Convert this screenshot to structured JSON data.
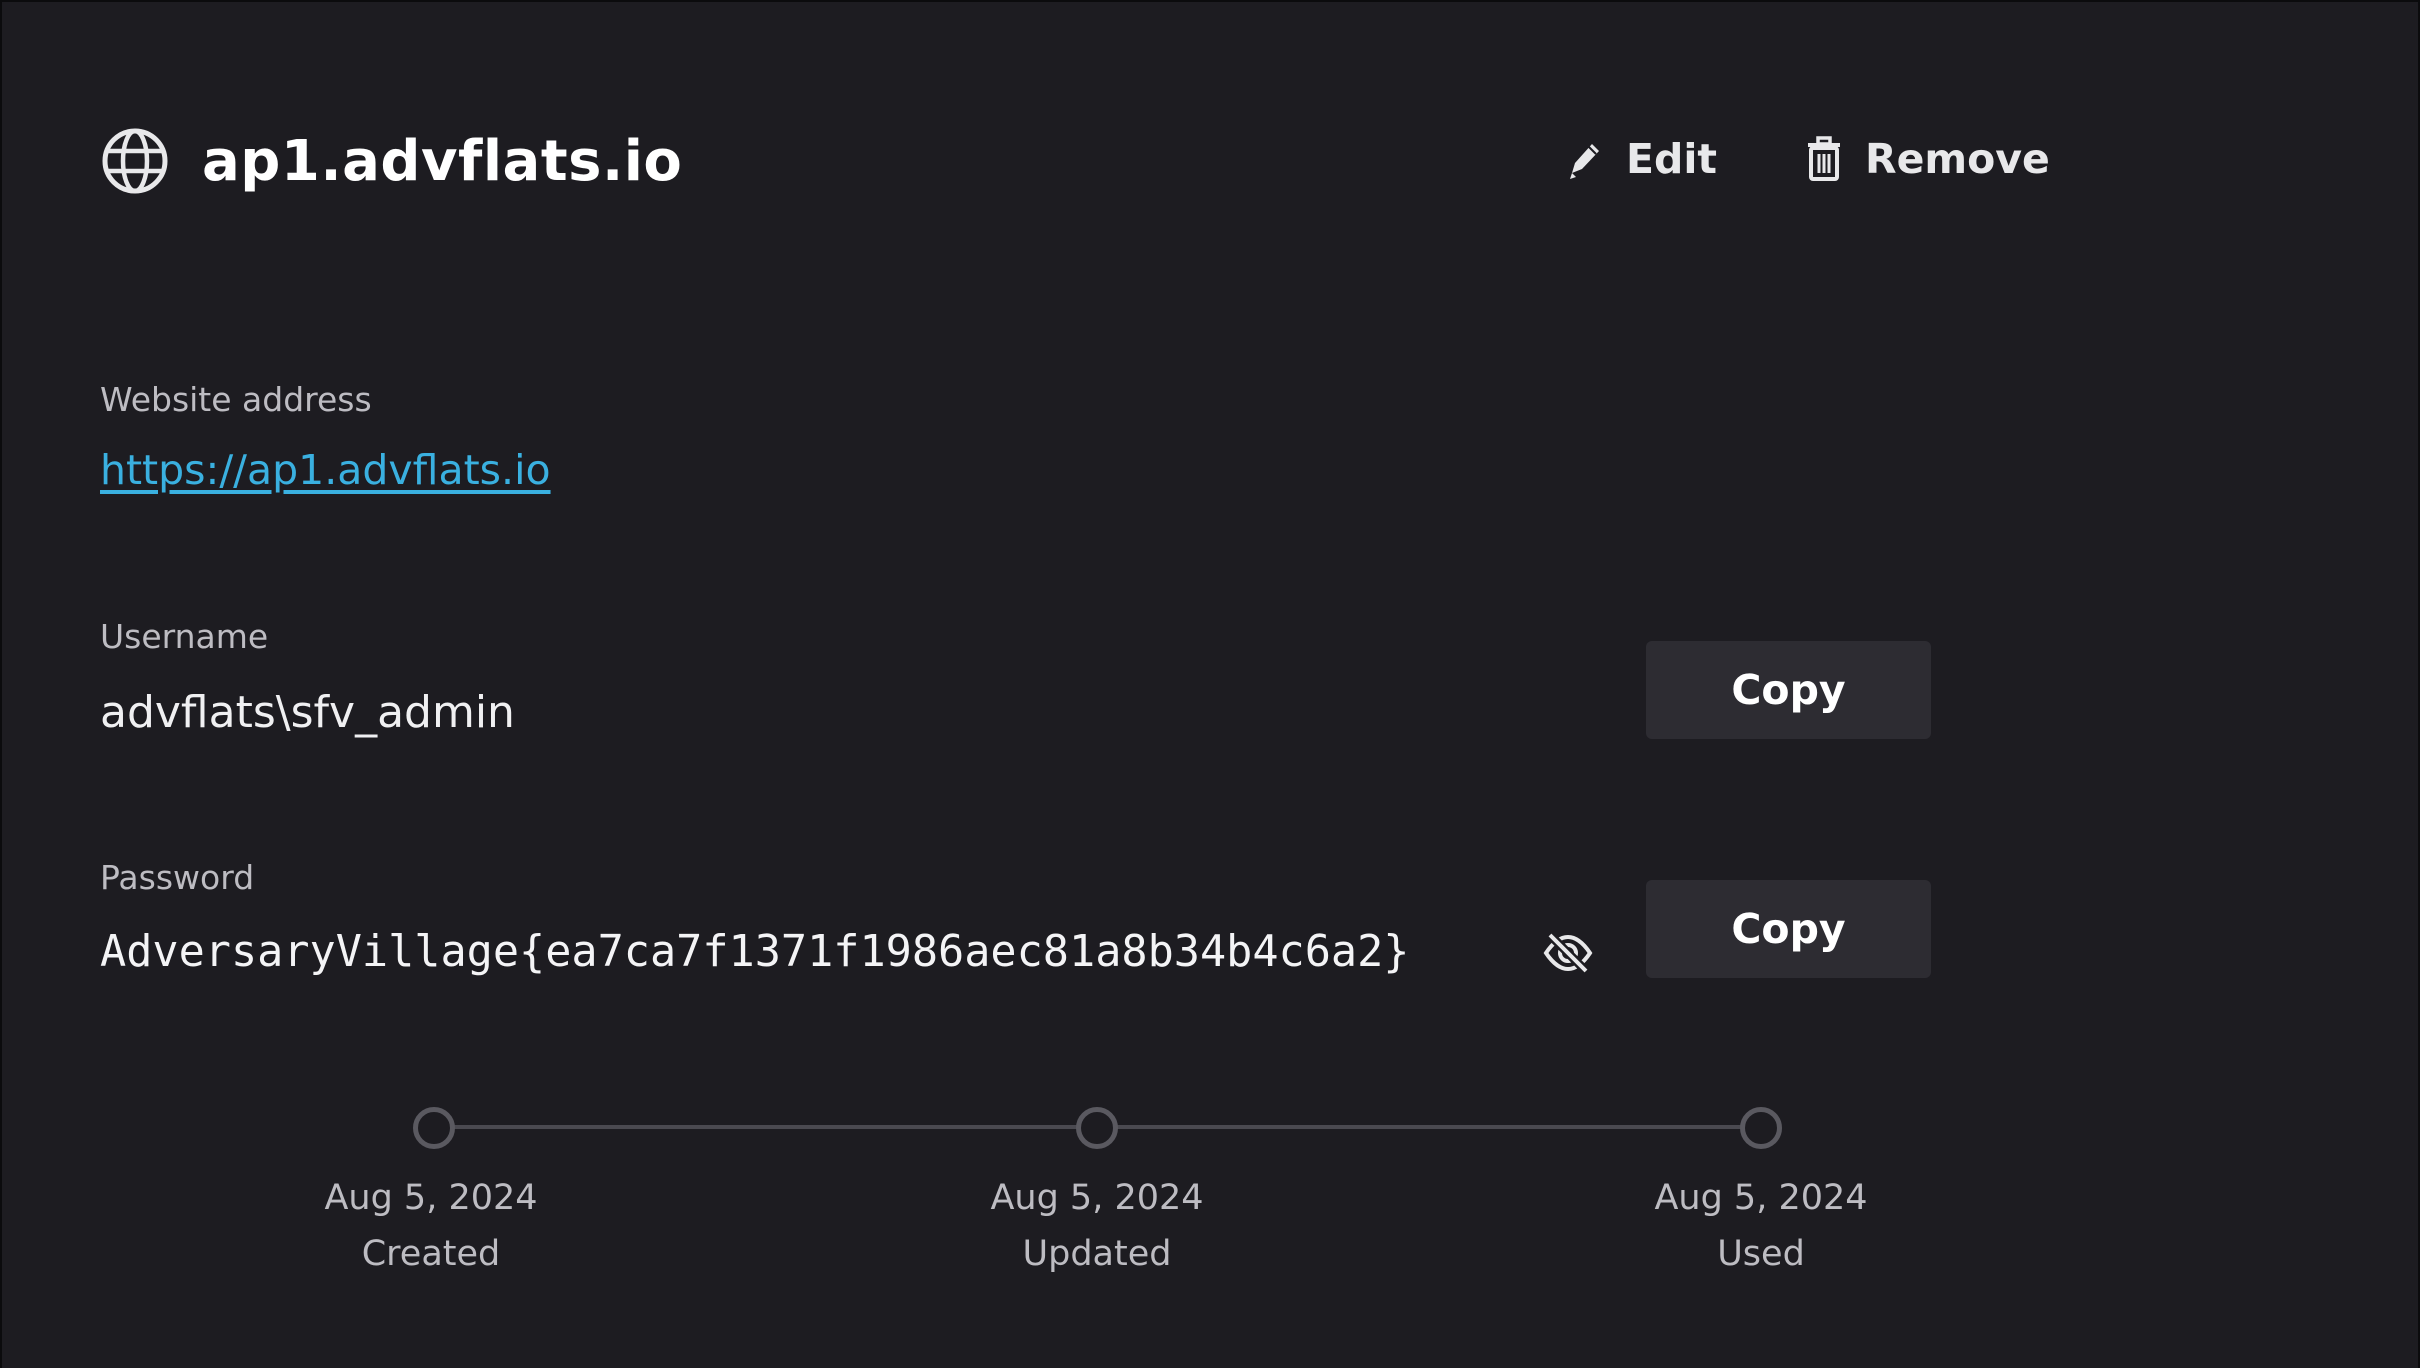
{
  "header": {
    "site_title": "ap1.advflats.io",
    "edit_label": "Edit",
    "remove_label": "Remove"
  },
  "website": {
    "label": "Website address",
    "url": "https://ap1.advflats.io"
  },
  "username": {
    "label": "Username",
    "value": "advflats\\sfv_admin",
    "copy_label": "Copy"
  },
  "password": {
    "label": "Password",
    "value": "AdversaryVillage{ea7ca7f1371f1986aec81a8b34b4c6a2}",
    "copy_label": "Copy",
    "visibility_icon": "eye-slash-icon"
  },
  "timeline": [
    {
      "date": "Aug 5, 2024",
      "label": "Created"
    },
    {
      "date": "Aug 5, 2024",
      "label": "Updated"
    },
    {
      "date": "Aug 5, 2024",
      "label": "Used"
    }
  ],
  "colors": {
    "background": "#1d1c21",
    "link": "#3ab0e0",
    "button_bg": "#2d2c32",
    "muted_text": "#bdbcc2"
  }
}
